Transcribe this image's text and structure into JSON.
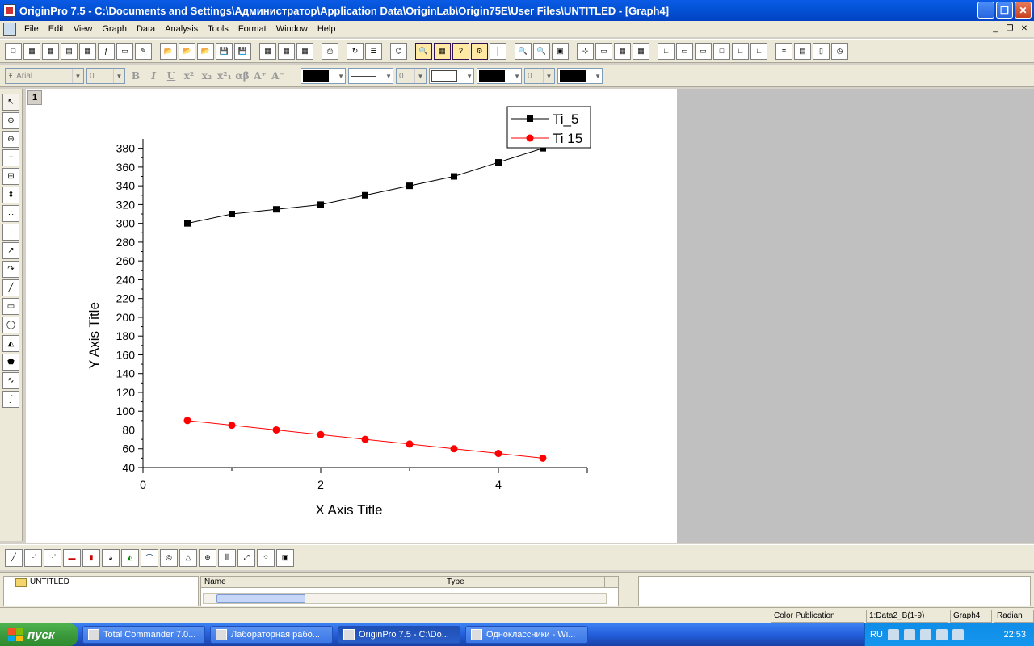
{
  "window": {
    "title": "OriginPro 7.5 - C:\\Documents and Settings\\Администратор\\Application Data\\OriginLab\\Origin75E\\User Files\\UNTITLED - [Graph4]"
  },
  "menu": [
    "File",
    "Edit",
    "View",
    "Graph",
    "Data",
    "Analysis",
    "Tools",
    "Format",
    "Window",
    "Help"
  ],
  "format_toolbar": {
    "font": "Arial",
    "size": "0",
    "line_size": "0",
    "fmt_buttons": [
      "B",
      "I",
      "U",
      "x²",
      "x₂",
      "x²₁",
      "αβ",
      "A⁺",
      "A⁻"
    ]
  },
  "layer": {
    "number": "1"
  },
  "chart_data": {
    "type": "line",
    "xlabel": "X Axis Title",
    "ylabel": "Y Axis Title",
    "xlim": [
      0,
      5
    ],
    "ylim": [
      40,
      390
    ],
    "x_ticks": [
      0,
      2,
      4
    ],
    "y_ticks": [
      40,
      60,
      80,
      100,
      120,
      140,
      160,
      180,
      200,
      220,
      240,
      260,
      280,
      300,
      320,
      340,
      360,
      380
    ],
    "series": [
      {
        "name": "Ti_5",
        "color": "#000000",
        "marker": "square",
        "x": [
          0.5,
          1,
          1.5,
          2,
          2.5,
          3,
          3.5,
          4,
          4.5
        ],
        "y": [
          300,
          310,
          315,
          320,
          330,
          340,
          350,
          365,
          380
        ]
      },
      {
        "name": "Ti 15",
        "color": "#ff0000",
        "marker": "circle",
        "x": [
          0.5,
          1,
          1.5,
          2,
          2.5,
          3,
          3.5,
          4,
          4.5
        ],
        "y": [
          90,
          85,
          80,
          75,
          70,
          65,
          60,
          55,
          50
        ]
      }
    ],
    "legend": "top-right"
  },
  "explorer": {
    "folder": "UNTITLED",
    "col_name": "Name",
    "col_type": "Type"
  },
  "status": {
    "theme": "Color Publication",
    "dataset": "1:Data2_B(1-9)",
    "window": "Graph4",
    "angle": "Radian"
  },
  "taskbar": {
    "start": "пуск",
    "tasks": [
      "Total Commander 7.0...",
      "Лабораторная рабо...",
      "OriginPro 7.5 - C:\\Do...",
      "Одноклассники - Wi..."
    ],
    "lang": "RU",
    "clock": "22:53"
  }
}
